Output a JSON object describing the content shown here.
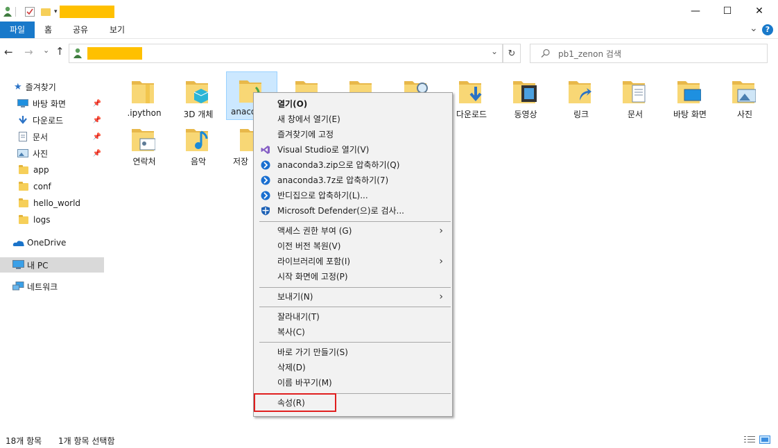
{
  "titlebar": {
    "minimize": "—",
    "maximize": "☐",
    "close": "✕",
    "expand_chevron": "⌄",
    "help": "?"
  },
  "ribbon": {
    "tabs": [
      "파일",
      "홈",
      "공유",
      "보기"
    ]
  },
  "nav_buttons": {
    "back": "←",
    "forward": "→",
    "recent": "⌄",
    "up": "↑"
  },
  "search": {
    "placeholder": "pb1_zenon 검색"
  },
  "sidebar": {
    "quick_access": "즐겨찾기",
    "items": [
      {
        "label": "바탕 화면",
        "icon": "desktop-icon",
        "pinned": true
      },
      {
        "label": "다운로드",
        "icon": "download-icon",
        "pinned": true
      },
      {
        "label": "문서",
        "icon": "document-icon",
        "pinned": true
      },
      {
        "label": "사진",
        "icon": "pictures-icon",
        "pinned": true
      },
      {
        "label": "app",
        "icon": "folder-icon",
        "pinned": false
      },
      {
        "label": "conf",
        "icon": "folder-icon",
        "pinned": false
      },
      {
        "label": "hello_world",
        "icon": "folder-icon",
        "pinned": false
      },
      {
        "label": "logs",
        "icon": "folder-icon",
        "pinned": false
      }
    ],
    "onedrive": "OneDrive",
    "this_pc": "내 PC",
    "network": "네트워크"
  },
  "files": [
    {
      "label": ".ipython",
      "icon": "folder-icon"
    },
    {
      "label": "3D 개체",
      "icon": "3d-objects-folder-icon"
    },
    {
      "label": "anaco",
      "icon": "folder-icon"
    },
    {
      "label": "",
      "icon": "folder-icon"
    },
    {
      "label": "",
      "icon": "folder-icon"
    },
    {
      "label": "",
      "icon": "folder-icon"
    },
    {
      "label": "다운로드",
      "icon": "downloads-folder-icon"
    },
    {
      "label": "동영상",
      "icon": "videos-folder-icon"
    },
    {
      "label": "링크",
      "icon": "links-folder-icon"
    },
    {
      "label": "문서",
      "icon": "documents-folder-icon"
    },
    {
      "label": "바탕 화면",
      "icon": "desktop-folder-icon"
    },
    {
      "label": "사진",
      "icon": "pictures-folder-icon"
    },
    {
      "label": "연락처",
      "icon": "contacts-folder-icon"
    },
    {
      "label": "음악",
      "icon": "music-folder-icon"
    },
    {
      "label": "저장",
      "icon": "saved-folder-icon"
    }
  ],
  "context_menu": {
    "items": [
      {
        "label": "열기(O)",
        "bold": true
      },
      {
        "label": "새 창에서 열기(E)"
      },
      {
        "label": "즐겨찾기에 고정"
      },
      {
        "label": "Visual Studio로 열기(V)",
        "icon": "visual-studio-icon"
      },
      {
        "label": "anaconda3.zip으로 압축하기(Q)",
        "icon": "bandizip-icon"
      },
      {
        "label": "anaconda3.7z로 압축하기(7)",
        "icon": "bandizip-icon"
      },
      {
        "label": "반디집으로 압축하기(L)...",
        "icon": "bandizip-icon"
      },
      {
        "label": "Microsoft Defender(으)로 검사...",
        "icon": "defender-icon"
      },
      {
        "label": "액세스 권한 부여 (G)",
        "submenu": true
      },
      {
        "label": "이전 버전 복원(V)"
      },
      {
        "label": "라이브러리에 포함(I)",
        "submenu": true
      },
      {
        "label": "시작 화면에 고정(P)"
      },
      {
        "label": "보내기(N)",
        "submenu": true
      },
      {
        "label": "잘라내기(T)"
      },
      {
        "label": "복사(C)"
      },
      {
        "label": "바로 가기 만들기(S)"
      },
      {
        "label": "삭제(D)"
      },
      {
        "label": "이름 바꾸기(M)"
      },
      {
        "label": "속성(R)"
      }
    ],
    "submenu_arrow": "›"
  },
  "status": {
    "count": "18개 항목",
    "selected": "1개 항목 선택함"
  },
  "colors": {
    "accent": "#1979ca",
    "highlight_box": "#e01e1e",
    "redacted": "#ffc000",
    "folder": "#f6cf59"
  }
}
